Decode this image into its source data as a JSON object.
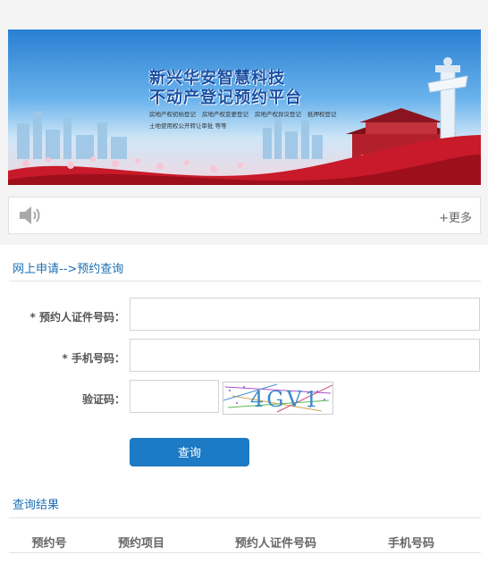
{
  "banner": {
    "title_line1": "新兴华安智慧科技",
    "title_line2": "不动产登记预约平台",
    "services": [
      "房地产权初始登记",
      "房地产权变更登记",
      "房地产权异议登记",
      "抵押权登记"
    ],
    "services_line2": "土地使用权公开转让审批 等等"
  },
  "notice": {
    "icon": "speaker-icon",
    "more_label": "+更多"
  },
  "breadcrumb": "网上申请-->预约查询",
  "form": {
    "id_label": "* 预约人证件号码：",
    "id_value": "",
    "phone_label": "* 手机号码：",
    "phone_value": "",
    "captcha_label": "验证码：",
    "captcha_value": "",
    "captcha_image_text": "4GV1",
    "submit_label": "查询"
  },
  "results": {
    "title": "查询结果",
    "columns": [
      "预约号",
      "预约项目",
      "预约人证件号码",
      "手机号码"
    ]
  },
  "colors": {
    "accent": "#1d7ac4",
    "link": "#1b6fb5",
    "banner_title": "#1a4fa3"
  }
}
